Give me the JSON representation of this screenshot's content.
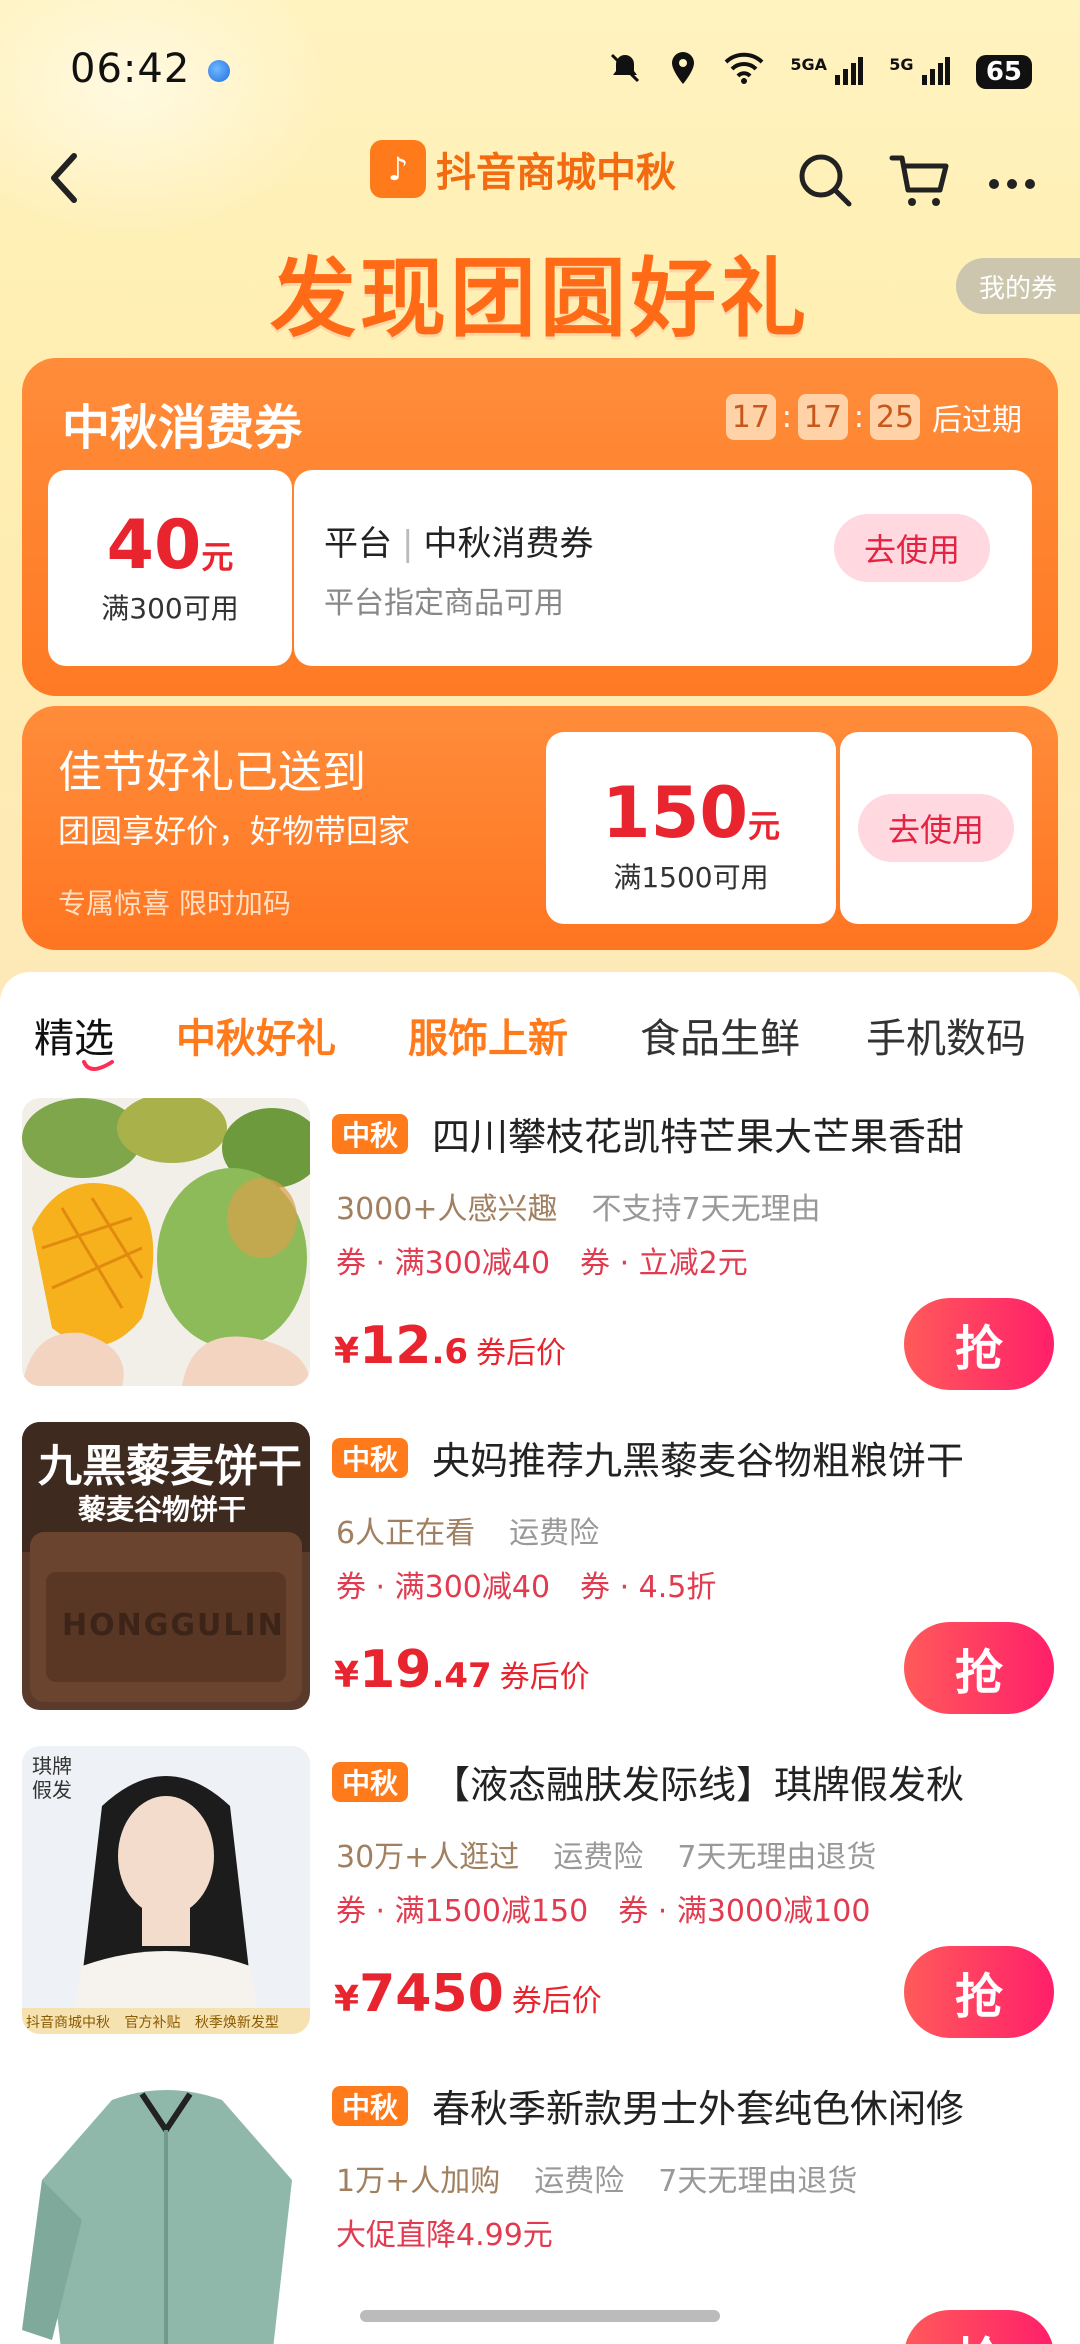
{
  "status": {
    "time": "06:42",
    "battery": "65",
    "signal1": "5GA",
    "signal2": "5G"
  },
  "nav": {
    "brand": "抖音商城中秋",
    "brand_logo_char": "♪"
  },
  "headline": "发现团圆好礼",
  "my_coupon": "我的券",
  "coupon1": {
    "title": "中秋消费券",
    "timer": {
      "h": "17",
      "m": "17",
      "s": "25",
      "suffix": "后过期"
    },
    "amount": "40",
    "unit": "元",
    "condition": "满300可用",
    "name_prefix": "平台",
    "name": "中秋消费券",
    "desc": "平台指定商品可用",
    "button": "去使用"
  },
  "coupon2": {
    "title": "佳节好礼已送到",
    "subtitle": "团圆享好价，好物带回家",
    "note": "专属惊喜 限时加码",
    "amount": "150",
    "unit": "元",
    "condition": "满1500可用",
    "button": "去使用"
  },
  "tabs": [
    "精选",
    "中秋好礼",
    "服饰上新",
    "食品生鲜",
    "手机数码"
  ],
  "products": [
    {
      "tag": "中秋",
      "title": "四川攀枝花凯特芒果大芒果香甜",
      "meta": [
        "3000+人感兴趣",
        "不支持7天无理由"
      ],
      "coupons": [
        "券 · 满300减40",
        "券 · 立减2元"
      ],
      "price_int": "12",
      "price_dec": ".6",
      "price_after": "券后价",
      "button": "抢"
    },
    {
      "tag": "中秋",
      "title": "央妈推荐九黑藜麦谷物粗粮饼干",
      "meta": [
        "6人正在看",
        "运费险"
      ],
      "coupons": [
        "券 · 满300减40",
        "券 · 4.5折"
      ],
      "price_int": "19",
      "price_dec": ".47",
      "price_after": "券后价",
      "button": "抢",
      "image_text": {
        "title": "九黑藜麦饼干",
        "sub": "藜麦谷物饼干",
        "brand": "HONGGULIN"
      }
    },
    {
      "tag": "中秋",
      "title": "【液态融肤发际线】琪牌假发秋",
      "meta": [
        "30万+人逛过",
        "运费险",
        "7天无理由退货"
      ],
      "coupons": [
        "券 · 满1500减150",
        "券 · 满3000减100"
      ],
      "price_int": "7450",
      "price_dec": "",
      "price_after": "券后价",
      "button": "抢",
      "image_text": {
        "corner": "琪牌假发",
        "badge1": "抖音商城中秋",
        "badge2": "官方补贴",
        "badge3": "秋季焕新发型"
      }
    },
    {
      "tag": "中秋",
      "title": "春秋季新款男士外套纯色休闲修",
      "meta": [
        "1万+人加购",
        "运费险",
        "7天无理由退货"
      ],
      "coupons": [
        "大促直降4.99元"
      ],
      "button": "抢"
    }
  ],
  "currency": "¥"
}
